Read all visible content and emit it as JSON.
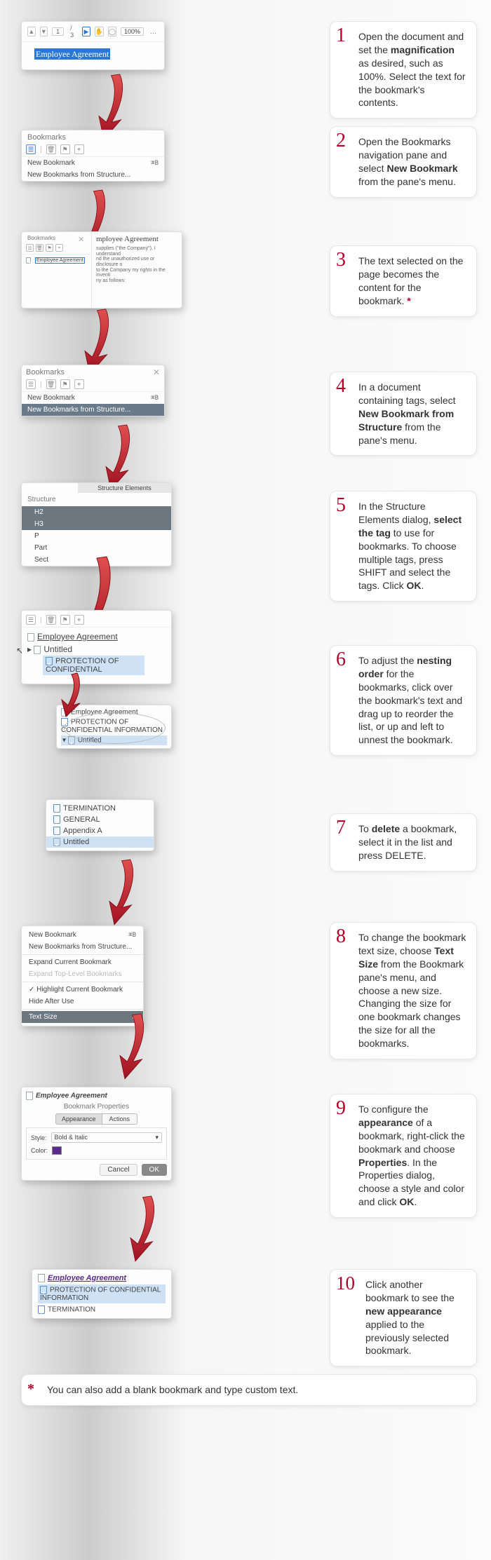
{
  "steps": {
    "s1": {
      "num": "1",
      "pre": "Open the document and set the ",
      "bold": "magnification",
      "post": " as desired, such as 100%. Select the text for the bookmark's contents."
    },
    "s2": {
      "num": "2",
      "pre": "Open the Bookmarks navigation pane and select ",
      "bold": "New Bookmark",
      "post": " from the pane's menu."
    },
    "s3": {
      "num": "3",
      "text": "The text selected on the page becomes the content for the bookmark. ",
      "star": "*"
    },
    "s4": {
      "num": "4",
      "pre": "In a document containing tags, select ",
      "bold": "New Bookmark from Structure",
      "post": " from the pane's menu."
    },
    "s5": {
      "num": "5",
      "pre": "In the Structure Elements dialog, ",
      "bold1": "select the tag",
      "mid": " to use for bookmarks. To choose multiple tags, press SHIFT and select the tags. Click ",
      "bold2": "OK",
      "post": "."
    },
    "s6": {
      "num": "6",
      "pre": "To adjust the ",
      "bold": "nesting order",
      "post": " for the bookmarks, click over the bookmark's text and drag up to reorder the list, or up and left to unnest the bookmark."
    },
    "s7": {
      "num": "7",
      "pre": "To ",
      "bold": "delete",
      "post": " a bookmark, select it in the list and press DELETE."
    },
    "s8": {
      "num": "8",
      "pre": "To change the bookmark text size, choose ",
      "bold": "Text Size",
      "post": " from the Bookmark pane's menu, and choose a new size. Changing the size for one bookmark changes the size for all the bookmarks."
    },
    "s9": {
      "num": "9",
      "pre": "To configure the ",
      "bold1": "appearance",
      "mid1": " of a bookmark, right-click the bookmark and choose ",
      "bold2": "Properties",
      "mid2": ". In the Properties dialog, choose a style and color and click ",
      "bold3": "OK",
      "post": "."
    },
    "s10": {
      "num": "10",
      "pre": "Click another bookmark to see the ",
      "bold": "new appearance",
      "post": " applied to the previously selected bookmark."
    }
  },
  "footnote": {
    "star": "*",
    "text": "You can also add a blank bookmark and type custom text."
  },
  "shot1": {
    "page_label": "1",
    "page_total": "/ 3",
    "zoom": "100%",
    "more": "…",
    "selected": "Employee  Agreement"
  },
  "shot2": {
    "title": "Bookmarks",
    "menu_new": "New Bookmark",
    "shortcut": "⌘B",
    "menu_struct": "New Bookmarks from Structure..."
  },
  "shot3": {
    "title": "Bookmarks",
    "bmk": "Employee Agreement",
    "page_title": "mployee  Agreement",
    "body": "supplies (\"the Company\"), I understand\nnd the unauthorized  use or disclosure o\nto the Company my rights in the inventi\nny  as follows:"
  },
  "shot4": {
    "title": "Bookmarks",
    "menu_new": "New Bookmark",
    "shortcut": "⌘B",
    "menu_struct": "New Bookmarks from Structure..."
  },
  "shot5": {
    "title": "Structure",
    "header": "Structure Elements",
    "rows": [
      "H2",
      "H3",
      "P",
      "Part",
      "Sect"
    ]
  },
  "shot6": {
    "items1": {
      "ea": "Employee Agreement",
      "unt": "Untitled",
      "prot": "PROTECTION OF CONFIDENTIAL"
    },
    "tooltip": {
      "ea": "Employee Agreement",
      "prot": "PROTECTION OF CONFIDENTIAL INFORMATION",
      "unt": "Untitled"
    }
  },
  "shot7": {
    "rows": [
      "TERMINATION",
      "GENERAL",
      "Appendix A",
      "Untitled"
    ]
  },
  "shot8": {
    "rows": [
      {
        "l": "New Bookmark",
        "r": "⌘B"
      },
      {
        "l": "New Bookmarks from Structure..."
      },
      {
        "l": "Expand Current Bookmark"
      },
      {
        "l": "Expand Top-Level Bookmarks",
        "disabled": true
      },
      {
        "l": "Highlight Current Bookmark",
        "check": true
      },
      {
        "l": "Hide After Use"
      },
      {
        "l": "Text Size",
        "arrow": true,
        "sel": true
      }
    ]
  },
  "shot9": {
    "bmk": "Employee Agreement",
    "dlg_title": "Bookmark Properties",
    "tab1": "Appearance",
    "tab2": "Actions",
    "style_l": "Style:",
    "style_v": "Bold & Italic",
    "color_l": "Color:",
    "cancel": "Cancel",
    "ok": "OK"
  },
  "shot10": {
    "bmk_styled": "Employee Agreement",
    "prot": "PROTECTION OF CONFIDENTIAL INFORMATION",
    "term": "TERMINATION"
  }
}
